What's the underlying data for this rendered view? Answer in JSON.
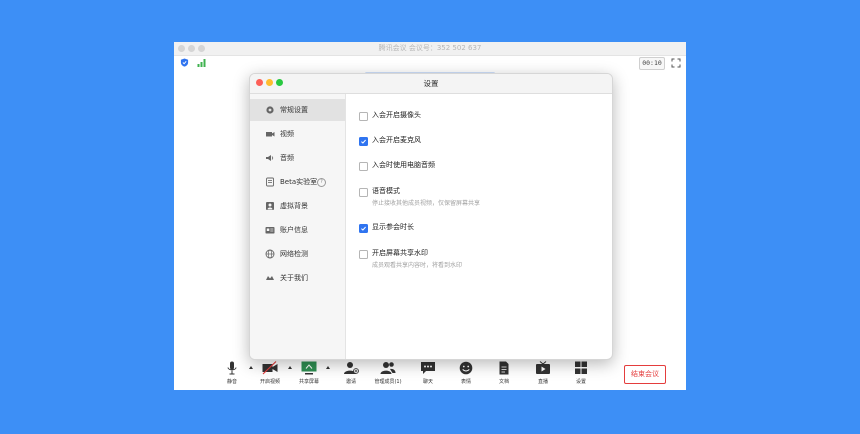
{
  "window": {
    "title": "腾讯会议 会议号：352 502 637"
  },
  "status": {
    "timer": "00:10"
  },
  "settings": {
    "title": "设置",
    "sidebar": [
      {
        "label": "常规设置",
        "icon": "gear-icon",
        "active": true
      },
      {
        "label": "视频",
        "icon": "camera-icon"
      },
      {
        "label": "音频",
        "icon": "speaker-icon"
      },
      {
        "label": "Beta实验室",
        "icon": "flask-icon",
        "help": "?"
      },
      {
        "label": "虚拟背景",
        "icon": "portrait-icon"
      },
      {
        "label": "账户信息",
        "icon": "id-card-icon"
      },
      {
        "label": "网络检测",
        "icon": "globe-icon"
      },
      {
        "label": "关于我们",
        "icon": "info-icon"
      }
    ],
    "options": [
      {
        "label": "入会开启摄像头",
        "checked": false
      },
      {
        "label": "入会开启麦克风",
        "checked": true
      },
      {
        "label": "入会时使用电脑音频",
        "checked": false
      },
      {
        "label": "语音模式",
        "desc": "停止接收其他成员视频，仅保留屏幕共享",
        "checked": false
      },
      {
        "label": "显示参会时长",
        "checked": true
      },
      {
        "label": "开启屏幕共享水印",
        "desc": "成员观看共享内容时，将看到水印",
        "checked": false
      }
    ]
  },
  "toolbar": {
    "mute": "静音",
    "video": "开启视频",
    "share": "共享屏幕",
    "invite": "邀请",
    "members": "管理成员(1)",
    "chat": "聊天",
    "emoji": "表情",
    "docs": "文档",
    "live": "直播",
    "settings": "设置",
    "end": "结束会议"
  },
  "colors": {
    "accent": "#2f74f0",
    "danger": "#e43d3d",
    "background": "#3d8ff6"
  }
}
